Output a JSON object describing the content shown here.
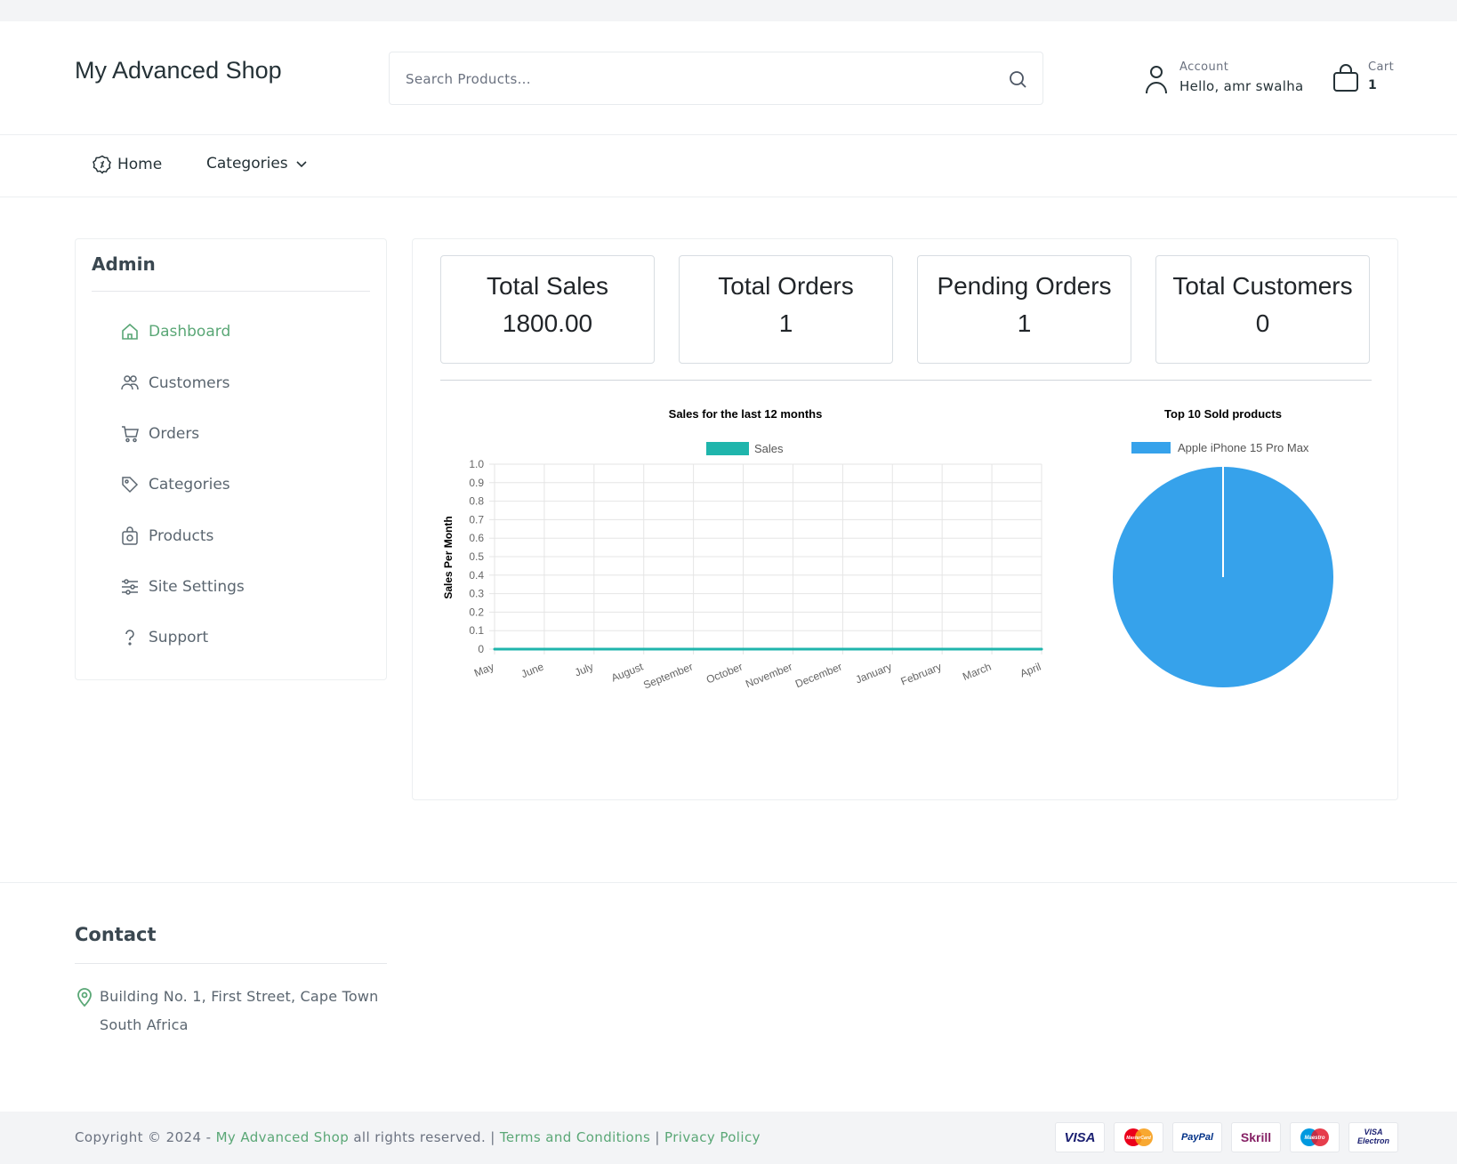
{
  "header": {
    "logo": "My Advanced Shop",
    "search_placeholder": "Search Products...",
    "account_label": "Account",
    "account_greeting": "Hello, amr swalha",
    "cart_label": "Cart",
    "cart_count": "1"
  },
  "nav": {
    "home": "Home",
    "categories": "Categories"
  },
  "sidebar": {
    "title": "Admin",
    "items": [
      {
        "label": "Dashboard",
        "icon": "home-icon"
      },
      {
        "label": "Customers",
        "icon": "users-icon"
      },
      {
        "label": "Orders",
        "icon": "cart-icon"
      },
      {
        "label": "Categories",
        "icon": "tag-icon"
      },
      {
        "label": "Products",
        "icon": "bag-icon"
      },
      {
        "label": "Site Settings",
        "icon": "sliders-icon"
      },
      {
        "label": "Support",
        "icon": "question-icon"
      }
    ]
  },
  "stats": [
    {
      "title": "Total Sales",
      "value": "1800.00"
    },
    {
      "title": "Total Orders",
      "value": "1"
    },
    {
      "title": "Pending Orders",
      "value": "1"
    },
    {
      "title": "Total Customers",
      "value": "0"
    }
  ],
  "chart_data": [
    {
      "type": "line",
      "title": "Sales for the last 12 months",
      "ylabel": "Sales Per Month",
      "xlabel": "",
      "categories": [
        "May",
        "June",
        "July",
        "August",
        "September",
        "October",
        "November",
        "December",
        "January",
        "February",
        "March",
        "April"
      ],
      "series": [
        {
          "name": "Sales",
          "values": [
            0,
            0,
            0,
            0,
            0,
            0,
            0,
            0,
            0,
            0,
            0,
            0
          ]
        }
      ],
      "ylim": [
        0,
        1.0
      ],
      "yticks": [
        "0",
        "0.1",
        "0.2",
        "0.3",
        "0.4",
        "0.5",
        "0.6",
        "0.7",
        "0.8",
        "0.9",
        "1.0"
      ],
      "grid": true,
      "legend": "top",
      "color": "#1fb5ac"
    },
    {
      "type": "pie",
      "title": "Top 10 Sold products",
      "categories": [
        "Apple iPhone 15 Pro Max"
      ],
      "values": [
        1
      ],
      "legend": "top",
      "color": "#36a2eb"
    }
  ],
  "footer": {
    "contact_title": "Contact",
    "address_line1": "Building No. 1, First Street, Cape Town",
    "address_line2": "South Africa",
    "copyright_prefix": "Copyright © 2024 -",
    "shop_link": "My Advanced Shop",
    "rights": "all rights reserved. |",
    "terms": "Terms and Conditions",
    "sep": "|",
    "privacy": "Privacy Policy",
    "payments": [
      "VISA",
      "MasterCard",
      "PayPal",
      "Skrill",
      "Maestro",
      "VISA Electron"
    ]
  },
  "colors": {
    "accent": "#5aa776",
    "line": "#1fb5ac",
    "pie": "#36a2eb"
  }
}
